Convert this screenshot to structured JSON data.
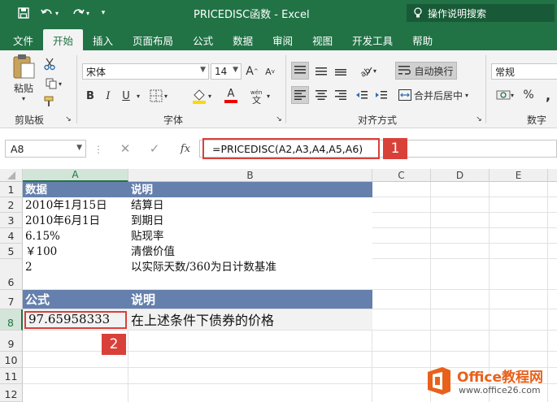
{
  "app": {
    "title": "PRICEDISC函数  -  Excel",
    "tell_me": "操作说明搜索"
  },
  "quick_access": {
    "save_icon": "save-icon",
    "undo_icon": "undo-icon",
    "redo_icon": "redo-icon",
    "customize_icon": "customize-icon"
  },
  "tabs": [
    "文件",
    "开始",
    "插入",
    "页面布局",
    "公式",
    "数据",
    "审阅",
    "视图",
    "开发工具",
    "帮助"
  ],
  "active_tab": "开始",
  "ribbon": {
    "clipboard": {
      "paste": "粘贴",
      "label": "剪贴板"
    },
    "font": {
      "name": "宋体",
      "size": "14",
      "bold": "B",
      "italic": "I",
      "underline": "U",
      "grow": "A",
      "shrink": "A",
      "font_color": "A",
      "label": "字体"
    },
    "alignment": {
      "wrap": "自动换行",
      "merge": "合并后居中",
      "label": "对齐方式"
    },
    "number": {
      "format": "常规",
      "percent": "%",
      "label": "数字"
    }
  },
  "formula_bar": {
    "name_box": "A8",
    "fx": "fx",
    "formula": "=PRICEDISC(A2,A3,A4,A5,A6)",
    "badge": "1"
  },
  "grid": {
    "columns": [
      "A",
      "B",
      "C",
      "D",
      "E"
    ],
    "rows": [
      "1",
      "2",
      "3",
      "4",
      "5",
      "6",
      "7",
      "8",
      "9",
      "10",
      "11",
      "12"
    ],
    "header_row": {
      "a": "数据",
      "b": "说明"
    },
    "data_rows": [
      {
        "a": "2010年1月15日",
        "b": "结算日"
      },
      {
        "a": "2010年6月1日",
        "b": "到期日"
      },
      {
        "a": "6.15%",
        "b": "贴现率"
      },
      {
        "a": "￥100",
        "b": "清偿价值"
      },
      {
        "a": "2",
        "b": "以实际天数/360为日计数基准"
      }
    ],
    "formula_header": {
      "a": "公式",
      "b": "说明"
    },
    "result": {
      "a": "97.65958333",
      "b": "在上述条件下债券的价格"
    },
    "badge": "2"
  },
  "watermark": {
    "brand": "Office教程网",
    "url": "www.office26.com"
  },
  "colors": {
    "excel_green": "#217346",
    "header_band": "#6680ad",
    "highlight_red": "#d9403a",
    "watermark_orange": "#e8611a"
  }
}
